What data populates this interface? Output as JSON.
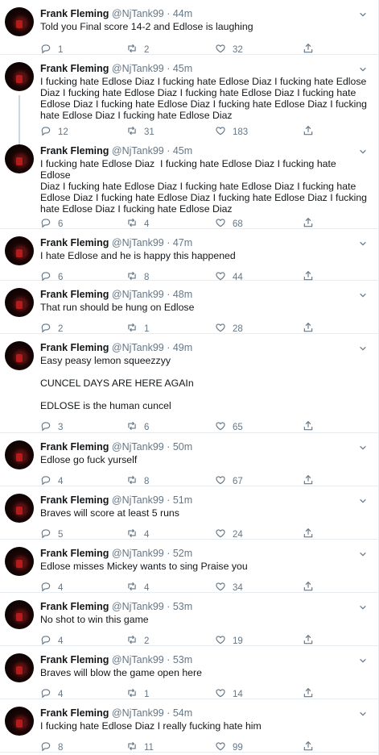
{
  "tweets": [
    {
      "name": "Frank Fleming",
      "handle": "@NjTank99",
      "time": "44m",
      "text": "Told you Final score 14-2 and Edlose is laughing",
      "replies": "1",
      "retweets": "2",
      "likes": "32"
    },
    {
      "name": "Frank Fleming",
      "handle": "@NjTank99",
      "time": "45m",
      "text": "I fucking hate Edlose Diaz I fucking hate Edlose Diaz I fucking hate Edlose\nDiaz I fucking hate Edlose Diaz I fucking hate Edlose Diaz I fucking hate\nEdlose Diaz I fucking hate Edlose Diaz I fucking hate Edlose Diaz I fucking\nhate Edlose Diaz I fucking hate Edlose Diaz",
      "replies": "12",
      "retweets": "31",
      "likes": "183"
    },
    {
      "name": "Frank Fleming",
      "handle": "@NjTank99",
      "time": "45m",
      "text": "I fucking hate Edlose Diaz  I fucking hate Edlose Diaz I fucking hate Edlose\nDiaz I fucking hate Edlose Diaz I fucking hate Edlose Diaz I fucking hate\nEdlose Diaz I fucking hate Edlose Diaz I fucking hate Edlose Diaz I fucking\nhate Edlose Diaz I fucking hate Edlose Diaz",
      "replies": "6",
      "retweets": "4",
      "likes": "68"
    },
    {
      "name": "Frank Fleming",
      "handle": "@NjTank99",
      "time": "47m",
      "text": "I hate Edlose and he is happy this happened",
      "replies": "6",
      "retweets": "8",
      "likes": "44"
    },
    {
      "name": "Frank Fleming",
      "handle": "@NjTank99",
      "time": "48m",
      "text": "That run should be hung on Edlose",
      "replies": "2",
      "retweets": "1",
      "likes": "28"
    },
    {
      "name": "Frank Fleming",
      "handle": "@NjTank99",
      "time": "49m",
      "text": "Easy peasy lemon squeezzyy\n\nCUNCEL DAYS ARE HERE AGAIn\n\nEDLOSE is the human cuncel",
      "replies": "3",
      "retweets": "6",
      "likes": "65"
    },
    {
      "name": "Frank Fleming",
      "handle": "@NjTank99",
      "time": "50m",
      "text": "Edlose go fuck yurself",
      "replies": "4",
      "retweets": "8",
      "likes": "67"
    },
    {
      "name": "Frank Fleming",
      "handle": "@NjTank99",
      "time": "51m",
      "text": "Braves will score at least 5 runs",
      "replies": "5",
      "retweets": "4",
      "likes": "24"
    },
    {
      "name": "Frank Fleming",
      "handle": "@NjTank99",
      "time": "52m",
      "text": "Edlose misses Mickey wants to sing Praise you",
      "replies": "4",
      "retweets": "4",
      "likes": "34"
    },
    {
      "name": "Frank Fleming",
      "handle": "@NjTank99",
      "time": "53m",
      "text": "No shot to win this game",
      "replies": "4",
      "retweets": "2",
      "likes": "19"
    },
    {
      "name": "Frank Fleming",
      "handle": "@NjTank99",
      "time": "53m",
      "text": "Braves will blow the game open here",
      "replies": "4",
      "retweets": "1",
      "likes": "14"
    },
    {
      "name": "Frank Fleming",
      "handle": "@NjTank99",
      "time": "54m",
      "text": "I fucking hate Edlose Diaz I really fucking hate him",
      "replies": "8",
      "retweets": "11",
      "likes": "99"
    }
  ],
  "icons": {
    "reply": "reply-icon",
    "retweet": "retweet-icon",
    "like": "heart-icon",
    "share": "share-icon",
    "more": "chevron-down-icon"
  },
  "colors": {
    "text": "#14171a",
    "secondary": "#657786",
    "border": "#e6ecf0",
    "thread": "#ccd6dd"
  }
}
